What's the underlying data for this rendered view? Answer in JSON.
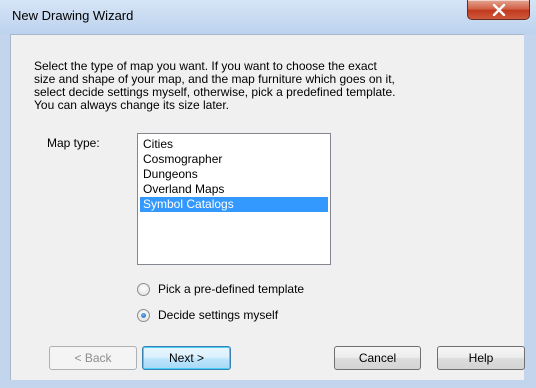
{
  "window": {
    "title": "New Drawing Wizard",
    "close_symbol": "x"
  },
  "instructions": "Select the type of map you want. If you want to choose the exact\nsize and shape of your map, and the map furniture which goes on it,\nselect decide settings myself, otherwise, pick a predefined template.\nYou can always change its size later.",
  "map_type": {
    "label": "Map type:",
    "items": [
      {
        "label": "Cities",
        "selected": false
      },
      {
        "label": "Cosmographer",
        "selected": false
      },
      {
        "label": "Dungeons",
        "selected": false
      },
      {
        "label": "Overland Maps",
        "selected": false
      },
      {
        "label": "Symbol Catalogs",
        "selected": true
      }
    ]
  },
  "options": {
    "template_label": "Pick a pre-defined template",
    "template_checked": false,
    "custom_label": "Decide settings myself",
    "custom_checked": true
  },
  "buttons": {
    "back": "< Back",
    "next": "Next >",
    "cancel": "Cancel",
    "help": "Help"
  },
  "colors": {
    "selection": "#3399ff",
    "close_button": "#c0391f",
    "default_button_border": "#3c7fb1"
  }
}
